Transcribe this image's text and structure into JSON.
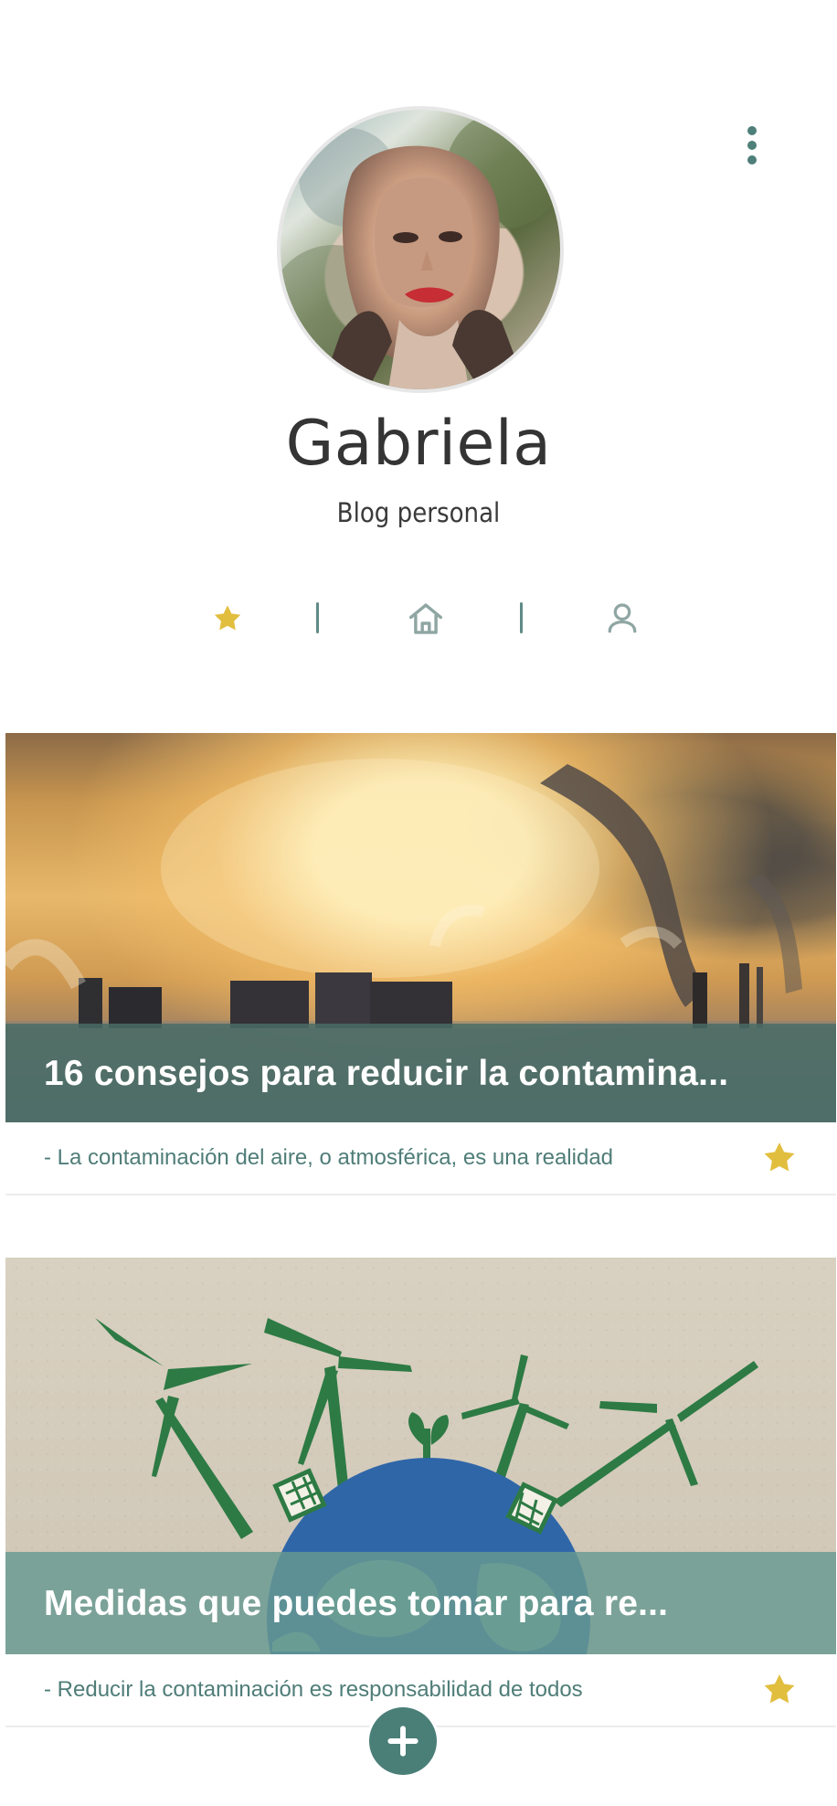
{
  "profile": {
    "name": "Gabriela",
    "subtitle": "Blog personal"
  },
  "icons": {
    "menu": "vertical-ellipsis",
    "tab_star": "star",
    "tab_home": "home",
    "tab_user": "user",
    "card_star": "star",
    "fab": "plus"
  },
  "colors": {
    "accent": "#4e7f79",
    "star": "#e2be3f",
    "icon_gray": "#8fa6a3"
  },
  "posts": [
    {
      "title": "16 consejos para reducir la contamina...",
      "excerpt": "- La contaminación del aire, o atmosférica, es una realidad"
    },
    {
      "title": "Medidas que puedes tomar para re...",
      "excerpt": "- Reducir la contaminación es responsabilidad de todos"
    }
  ]
}
